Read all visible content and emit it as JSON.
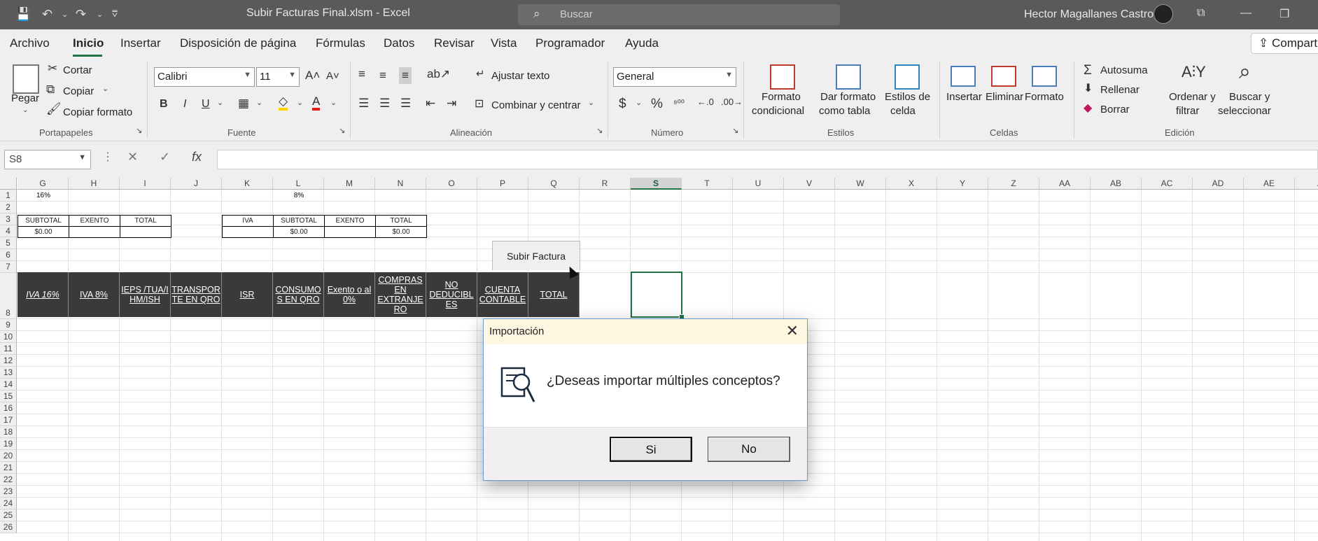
{
  "window": {
    "title": "Subir Facturas Final.xlsm  -  Excel",
    "search_placeholder": "Buscar",
    "user": "Hector Magallanes Castro"
  },
  "menu": {
    "tabs": [
      "Archivo",
      "Inicio",
      "Insertar",
      "Disposición de página",
      "Fórmulas",
      "Datos",
      "Revisar",
      "Vista",
      "Programador",
      "Ayuda"
    ],
    "active": "Inicio",
    "share_label": "Compartir"
  },
  "ribbon": {
    "clipboard": {
      "paste": "Pegar",
      "cut": "Cortar",
      "copy": "Copiar",
      "format_painter": "Copiar formato",
      "group": "Portapapeles"
    },
    "font": {
      "name": "Calibri",
      "size": "11",
      "bold": "B",
      "italic": "I",
      "underline": "U",
      "group": "Fuente"
    },
    "alignment": {
      "wrap": "Ajustar texto",
      "merge": "Combinar y centrar",
      "group": "Alineación"
    },
    "number": {
      "format": "General",
      "currency": "$",
      "percent": "%",
      "group": "Número"
    },
    "styles": {
      "conditional_1": "Formato",
      "conditional_2": "condicional",
      "table_1": "Dar formato",
      "table_2": "como tabla",
      "cell_styles_1": "Estilos de",
      "cell_styles_2": "celda",
      "group": "Estilos"
    },
    "cells": {
      "insert": "Insertar",
      "delete": "Eliminar",
      "format": "Formato",
      "group": "Celdas"
    },
    "editing": {
      "autosum": "Autosuma",
      "fill": "Rellenar",
      "clear": "Borrar",
      "sort_1": "Ordenar y",
      "sort_2": "filtrar",
      "find_1": "Buscar y",
      "find_2": "seleccionar",
      "group": "Edición"
    }
  },
  "formula_bar": {
    "name_box": "S8",
    "formula": ""
  },
  "sheet": {
    "columns": [
      "G",
      "H",
      "I",
      "J",
      "K",
      "L",
      "M",
      "N",
      "O",
      "P",
      "Q",
      "R",
      "S",
      "T",
      "U",
      "V",
      "W",
      "X",
      "Y",
      "Z",
      "AA",
      "AB",
      "AC",
      "AD",
      "AE",
      "A"
    ],
    "selected_column": "S",
    "rows": [
      "1",
      "2",
      "3",
      "4",
      "5",
      "6",
      "7",
      "8",
      "9",
      "10",
      "11",
      "12",
      "13",
      "14",
      "15",
      "16",
      "17",
      "18",
      "19",
      "20",
      "21",
      "22",
      "23",
      "24",
      "25",
      "26"
    ],
    "row1": {
      "g": "16%",
      "l": "8%"
    },
    "table1_headers": [
      "SUBTOTAL",
      "EXENTO",
      "TOTAL"
    ],
    "table1_values": [
      "$0.00",
      "",
      ""
    ],
    "table2_headers": [
      "IVA",
      "SUBTOTAL",
      "EXENTO",
      "TOTAL"
    ],
    "table2_values": [
      "",
      "$0.00",
      "",
      "$0.00"
    ],
    "header_row": [
      "IVA 16%",
      "IVA 8%",
      "IEPS /TUA/I HM/ISH",
      "TRANSPOR TE EN QRO",
      "ISR",
      "CONSUMO S EN QRO",
      "Exento o al 0%",
      "COMPRAS EN EXTRANJE RO",
      "NO DEDUCIBL ES",
      "CUENTA CONTABLE",
      "TOTAL"
    ],
    "subir_button": "Subir Factura"
  },
  "dialog": {
    "title": "Importación",
    "message": "¿Deseas importar múltiples conceptos?",
    "yes": "Si",
    "no": "No",
    "close": "✕"
  }
}
